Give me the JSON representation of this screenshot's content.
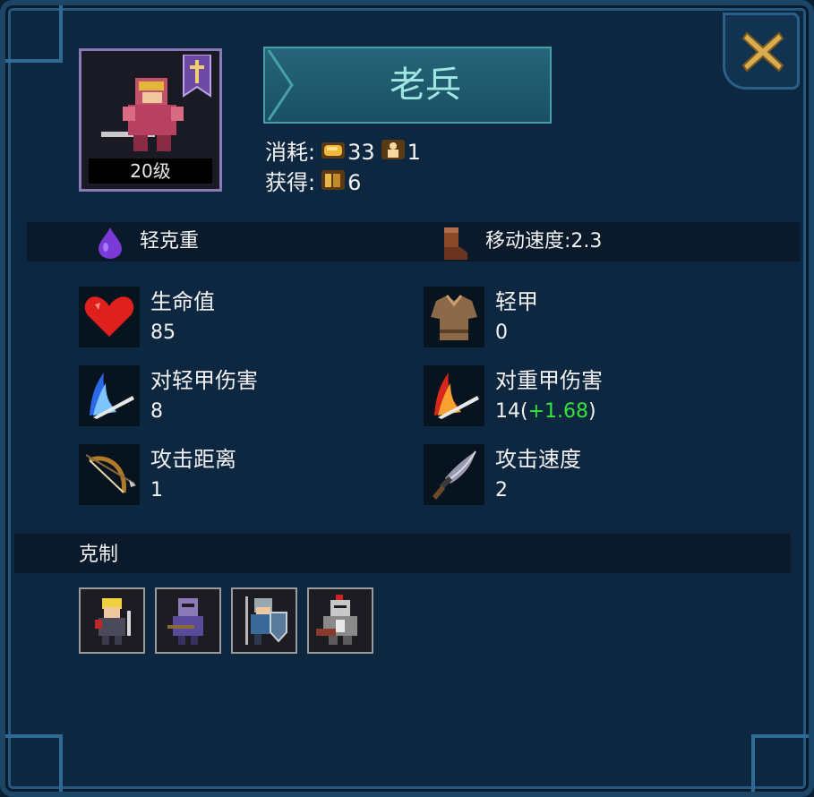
{
  "unit": {
    "name": "老兵",
    "level_label": "20级"
  },
  "cost": {
    "consume_label": "消耗:",
    "gold": "33",
    "population": "1",
    "gain_label": "获得:",
    "reward": "6"
  },
  "traits": {
    "armor_class": "轻克重",
    "move_speed": "移动速度:2.3"
  },
  "stats": [
    {
      "label": "生命值",
      "value": "85",
      "icon": "heart-icon"
    },
    {
      "label": "轻甲",
      "value": "0",
      "icon": "light-armor-icon"
    },
    {
      "label": "对轻甲伤害",
      "value": "8",
      "icon": "blue-slash-icon"
    },
    {
      "label": "对重甲伤害",
      "value": "14(",
      "bonus": "+1.68",
      "suffix": ")",
      "icon": "red-slash-icon"
    },
    {
      "label": "攻击距离",
      "value": "1",
      "icon": "bow-icon"
    },
    {
      "label": "攻击速度",
      "value": "2",
      "icon": "dagger-icon"
    }
  ],
  "counters": {
    "title": "克制",
    "units": [
      "blonde-swordsman",
      "purple-knight",
      "shield-spearman",
      "heavy-red-plume-knight"
    ]
  },
  "colors": {
    "background": "#0e2740",
    "title_text": "#9fe7e1",
    "bonus": "#36e23c",
    "portrait_border": "#8a7ab8"
  }
}
